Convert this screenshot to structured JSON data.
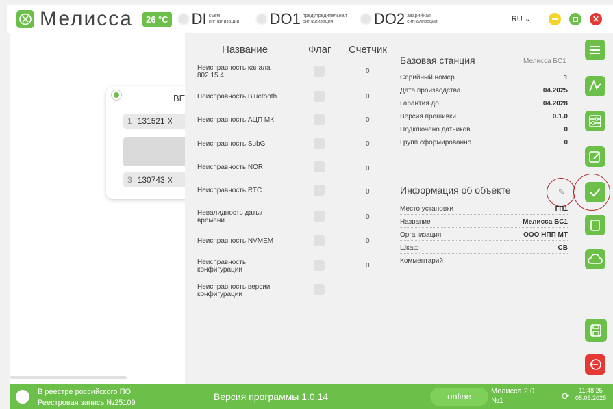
{
  "header": {
    "app_name": "Мелисса",
    "temperature": "26 °C",
    "signals": [
      {
        "code": "DI",
        "label": "съем сигнализации"
      },
      {
        "code": "DO1",
        "label": "предупредительная сигнализация"
      },
      {
        "code": "DO2",
        "label": "аварийная сигнализация"
      }
    ],
    "language": "RU",
    "window_buttons": {
      "minimize_color": "#f5d327",
      "maximize_color": "#6cc04a",
      "close_color": "#e53935"
    }
  },
  "left_panel": {
    "card_title": "BE",
    "rows": [
      {
        "index": "1",
        "value": "131521"
      },
      {
        "index": "3",
        "value": "130743"
      }
    ]
  },
  "middle": {
    "headers": {
      "name": "Название",
      "flag": "Флаг",
      "counter": "Счетчик"
    },
    "rows": [
      {
        "name": "Неисправность канала 802.15.4",
        "counter": "0"
      },
      {
        "name": "Неисправность Bluetooth",
        "counter": "0"
      },
      {
        "name": "Неисправность АЦП МК",
        "counter": "0"
      },
      {
        "name": "Неисправность SubG",
        "counter": "0"
      },
      {
        "name": "Неисправность NOR",
        "counter": "0"
      },
      {
        "name": "Неисправность RTC",
        "counter": "0"
      },
      {
        "name": "Невалидность даты/ времени",
        "counter": "0"
      },
      {
        "name": "Неисправность NVMEM",
        "counter": "0"
      },
      {
        "name": "Неисправность конфигурации",
        "counter": "0"
      },
      {
        "name": "Неисправность версии конфигурации",
        "counter": ""
      }
    ]
  },
  "base_station": {
    "title": "Базовая станция",
    "subtitle": "Мелисса БС1",
    "fields": [
      {
        "key": "Серийный номер",
        "value": "1"
      },
      {
        "key": "Дата производства",
        "value": "04.2025"
      },
      {
        "key": "Гарантия до",
        "value": "04.2028"
      },
      {
        "key": "Версия прошивки",
        "value": "0.1.0"
      },
      {
        "key": "Подключено датчиков",
        "value": "0"
      },
      {
        "key": "Групп сформированно",
        "value": "0"
      }
    ]
  },
  "object_info": {
    "title": "Информация об объекте",
    "fields": [
      {
        "key": "Место установки",
        "value": "ГП1"
      },
      {
        "key": "Название",
        "value": "Мелисса БС1"
      },
      {
        "key": "Организация",
        "value": "ООО НПП МТ"
      },
      {
        "key": "Шкаф",
        "value": "СВ"
      },
      {
        "key": "Комментарий",
        "value": ""
      }
    ]
  },
  "sidebar": {
    "icons": [
      "list-icon",
      "chart-icon",
      "sliders-icon",
      "edit-icon",
      "check-icon",
      "document-icon",
      "cloud-icon",
      "save-icon",
      "exit-icon"
    ]
  },
  "footer": {
    "registry_line1": "В реестре российского ПО",
    "registry_line2": "Реестровая запись №25109",
    "version_label": "Версия программы  1.0.14",
    "status": "online",
    "device_line1": "Мелисса 2.0",
    "device_line2": "№1",
    "time": "11:48:25",
    "date": "05.06.2025"
  }
}
